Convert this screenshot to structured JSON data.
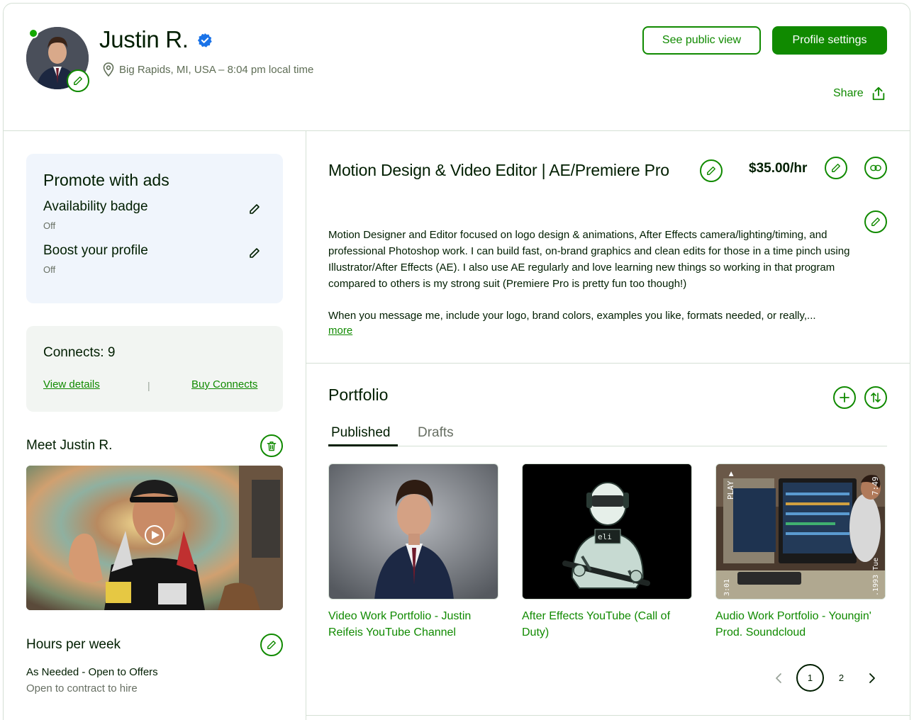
{
  "profile": {
    "name": "Justin R.",
    "location": "Big Rapids, MI, USA – 8:04 pm local time"
  },
  "header": {
    "public_view_label": "See public view",
    "settings_label": "Profile settings",
    "share_label": "Share"
  },
  "promote": {
    "title": "Promote with ads",
    "items": [
      {
        "label": "Availability badge",
        "status": "Off"
      },
      {
        "label": "Boost your profile",
        "status": "Off"
      }
    ]
  },
  "connects": {
    "label": "Connects: 9",
    "view_details": "View details",
    "separator": "|",
    "buy": "Buy Connects"
  },
  "intro_video": {
    "title": "Meet Justin R."
  },
  "hours": {
    "title": "Hours per week",
    "value": "As Needed - Open to Offers",
    "sub": "Open to contract to hire"
  },
  "main": {
    "title": "Motion Design & Video Editor | AE/Premiere Pro",
    "rate": "$35.00/hr",
    "description": [
      "Motion Designer and Editor focused on logo design & animations, After Effects camera/lighting/timing, and professional Photoshop work. I can build fast, on-brand graphics and clean edits for those in a time pinch using Illustrator/After Effects (AE). I also use AE regularly and love learning new things so working in that program compared to others is my strong suit (Premiere Pro is pretty fun too though!)",
      "When you message me, include your logo, brand colors, examples you like, formats needed, or really,..."
    ],
    "more_label": "more"
  },
  "portfolio": {
    "title": "Portfolio",
    "tabs": [
      {
        "label": "Published",
        "active": true
      },
      {
        "label": "Drafts",
        "active": false
      }
    ],
    "items": [
      {
        "label": "Video Work Portfolio - Justin Reifeis YouTube Channel"
      },
      {
        "label": "After Effects YouTube (Call of Duty)",
        "overlay_text": "eli"
      },
      {
        "label": "Audio Work Portfolio - Youngin' Prod. Soundcloud",
        "overlay_play": "PLAY ▶",
        "overlay_time": "7:49",
        "overlay_date": ".1993 Tue",
        "overlay_clock": "3:01"
      }
    ],
    "pagination": {
      "pages": [
        "1",
        "2"
      ],
      "current": "1"
    }
  },
  "colors": {
    "brand_green": "#108a00",
    "text_dark": "#001e00",
    "text_muted": "#5e6d55",
    "verified_blue": "#1a73e8",
    "online_green": "#14a800"
  },
  "icons": [
    "pencil-icon",
    "verified-badge-icon",
    "location-pin-icon",
    "share-icon",
    "trash-icon",
    "link-icon",
    "plus-icon",
    "sort-icon",
    "play-icon",
    "chevron-left-icon",
    "chevron-right-icon"
  ]
}
